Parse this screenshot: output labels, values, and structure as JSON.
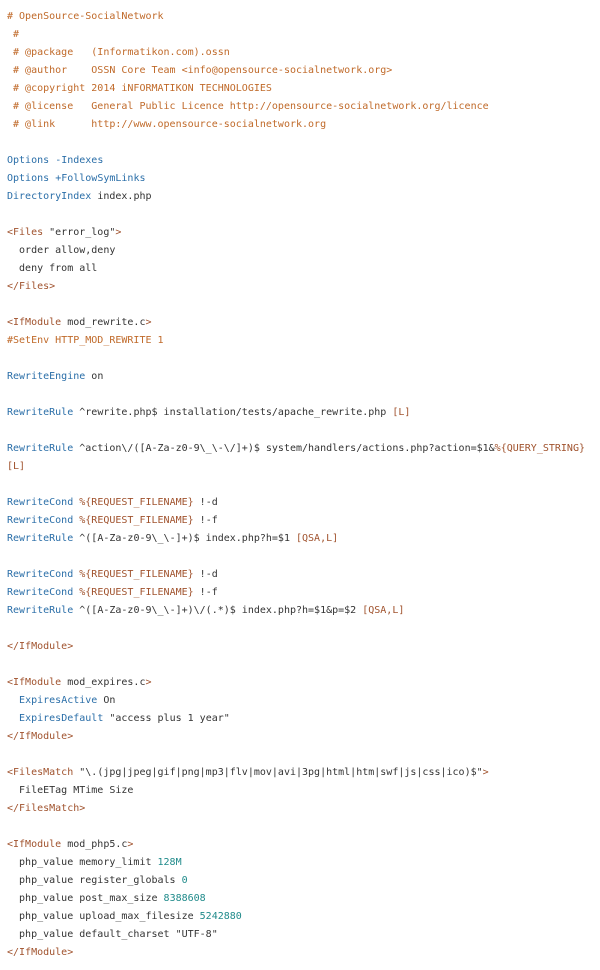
{
  "file": {
    "lines": [
      [
        {
          "c": "comment",
          "t": "# OpenSource-SocialNetwork"
        }
      ],
      [
        {
          "c": "comment",
          "t": " #"
        }
      ],
      [
        {
          "c": "comment",
          "t": " # @package   (Informatikon.com).ossn"
        }
      ],
      [
        {
          "c": "comment",
          "t": " # @author    OSSN Core Team <info@opensource-socialnetwork.org>"
        }
      ],
      [
        {
          "c": "comment",
          "t": " # @copyright 2014 iNFORMATIKON TECHNOLOGIES"
        }
      ],
      [
        {
          "c": "comment",
          "t": " # @license   General Public Licence http://opensource-socialnetwork.org/licence"
        }
      ],
      [
        {
          "c": "comment",
          "t": " # @link      http://www.opensource-socialnetwork.org"
        }
      ],
      [],
      [
        {
          "c": "directive",
          "t": "Options"
        },
        {
          "c": "plain",
          "t": " "
        },
        {
          "c": "directive",
          "t": "-Indexes"
        }
      ],
      [
        {
          "c": "directive",
          "t": "Options"
        },
        {
          "c": "plain",
          "t": " "
        },
        {
          "c": "directive",
          "t": "+FollowSymLinks"
        }
      ],
      [
        {
          "c": "directive",
          "t": "DirectoryIndex"
        },
        {
          "c": "plain",
          "t": " index.php"
        }
      ],
      [],
      [
        {
          "c": "tag",
          "t": "<Files"
        },
        {
          "c": "plain",
          "t": " \"error_log\""
        },
        {
          "c": "tag",
          "t": ">"
        }
      ],
      [
        {
          "c": "plain",
          "t": "  order allow,deny"
        }
      ],
      [
        {
          "c": "plain",
          "t": "  deny from all"
        }
      ],
      [
        {
          "c": "tag",
          "t": "</Files>"
        }
      ],
      [],
      [
        {
          "c": "tag",
          "t": "<IfModule"
        },
        {
          "c": "plain",
          "t": " mod_rewrite.c"
        },
        {
          "c": "tag",
          "t": ">"
        }
      ],
      [
        {
          "c": "comment",
          "t": "#SetEnv HTTP_MOD_REWRITE 1"
        }
      ],
      [],
      [
        {
          "c": "directive",
          "t": "RewriteEngine"
        },
        {
          "c": "plain",
          "t": " on"
        }
      ],
      [],
      [
        {
          "c": "directive",
          "t": "RewriteRule"
        },
        {
          "c": "plain",
          "t": " ^rewrite.php$ installation/tests/apache_rewrite.php "
        },
        {
          "c": "flag",
          "t": "[L]"
        }
      ],
      [],
      [
        {
          "c": "directive",
          "t": "RewriteRule"
        },
        {
          "c": "plain",
          "t": " ^action\\/([A-Za-z0-9\\_\\-\\/]+)$ system/handlers/actions.php?action=$1&"
        },
        {
          "c": "var",
          "t": "%{QUERY_STRING}"
        }
      ],
      [
        {
          "c": "flag",
          "t": "[L]"
        }
      ],
      [],
      [
        {
          "c": "directive",
          "t": "RewriteCond"
        },
        {
          "c": "plain",
          "t": " "
        },
        {
          "c": "var",
          "t": "%{REQUEST_FILENAME}"
        },
        {
          "c": "plain",
          "t": " !-d"
        }
      ],
      [
        {
          "c": "directive",
          "t": "RewriteCond"
        },
        {
          "c": "plain",
          "t": " "
        },
        {
          "c": "var",
          "t": "%{REQUEST_FILENAME}"
        },
        {
          "c": "plain",
          "t": " !-f"
        }
      ],
      [
        {
          "c": "directive",
          "t": "RewriteRule"
        },
        {
          "c": "plain",
          "t": " ^([A-Za-z0-9\\_\\-]+)$ index.php?h=$1 "
        },
        {
          "c": "flag",
          "t": "[QSA,L]"
        }
      ],
      [],
      [
        {
          "c": "directive",
          "t": "RewriteCond"
        },
        {
          "c": "plain",
          "t": " "
        },
        {
          "c": "var",
          "t": "%{REQUEST_FILENAME}"
        },
        {
          "c": "plain",
          "t": " !-d"
        }
      ],
      [
        {
          "c": "directive",
          "t": "RewriteCond"
        },
        {
          "c": "plain",
          "t": " "
        },
        {
          "c": "var",
          "t": "%{REQUEST_FILENAME}"
        },
        {
          "c": "plain",
          "t": " !-f"
        }
      ],
      [
        {
          "c": "directive",
          "t": "RewriteRule"
        },
        {
          "c": "plain",
          "t": " ^([A-Za-z0-9\\_\\-]+)\\/(.*)$ index.php?h=$1&p=$2 "
        },
        {
          "c": "flag",
          "t": "[QSA,L]"
        }
      ],
      [],
      [
        {
          "c": "tag",
          "t": "</IfModule>"
        }
      ],
      [],
      [
        {
          "c": "tag",
          "t": "<IfModule"
        },
        {
          "c": "plain",
          "t": " mod_expires.c"
        },
        {
          "c": "tag",
          "t": ">"
        }
      ],
      [
        {
          "c": "plain",
          "t": "  "
        },
        {
          "c": "directive",
          "t": "ExpiresActive"
        },
        {
          "c": "plain",
          "t": " On"
        }
      ],
      [
        {
          "c": "plain",
          "t": "  "
        },
        {
          "c": "directive",
          "t": "ExpiresDefault"
        },
        {
          "c": "plain",
          "t": " \"access plus 1 year\""
        }
      ],
      [
        {
          "c": "tag",
          "t": "</IfModule>"
        }
      ],
      [],
      [
        {
          "c": "tag",
          "t": "<FilesMatch"
        },
        {
          "c": "plain",
          "t": " \"\\.(jpg|jpeg|gif|png|mp3|flv|mov|avi|3pg|html|htm|swf|js|css|ico)$\""
        },
        {
          "c": "tag",
          "t": ">"
        }
      ],
      [
        {
          "c": "plain",
          "t": "  FileETag MTime Size"
        }
      ],
      [
        {
          "c": "tag",
          "t": "</FilesMatch>"
        }
      ],
      [],
      [
        {
          "c": "tag",
          "t": "<IfModule"
        },
        {
          "c": "plain",
          "t": " mod_php5.c"
        },
        {
          "c": "tag",
          "t": ">"
        }
      ],
      [
        {
          "c": "plain",
          "t": "  php_value memory_limit "
        },
        {
          "c": "number",
          "t": "128M"
        }
      ],
      [
        {
          "c": "plain",
          "t": "  php_value register_globals "
        },
        {
          "c": "number",
          "t": "0"
        }
      ],
      [
        {
          "c": "plain",
          "t": "  php_value post_max_size "
        },
        {
          "c": "number",
          "t": "8388608"
        }
      ],
      [
        {
          "c": "plain",
          "t": "  php_value upload_max_filesize "
        },
        {
          "c": "number",
          "t": "5242880"
        }
      ],
      [
        {
          "c": "plain",
          "t": "  php_value default_charset \"UTF-8\""
        }
      ],
      [
        {
          "c": "tag",
          "t": "</IfModule>"
        }
      ]
    ]
  },
  "colors": {
    "comment": "#c06a2a",
    "directive": "#2a6ea8",
    "tag": "#a0522d",
    "plain": "#333333",
    "number": "#1f8a8a",
    "background": "#ffffff"
  }
}
